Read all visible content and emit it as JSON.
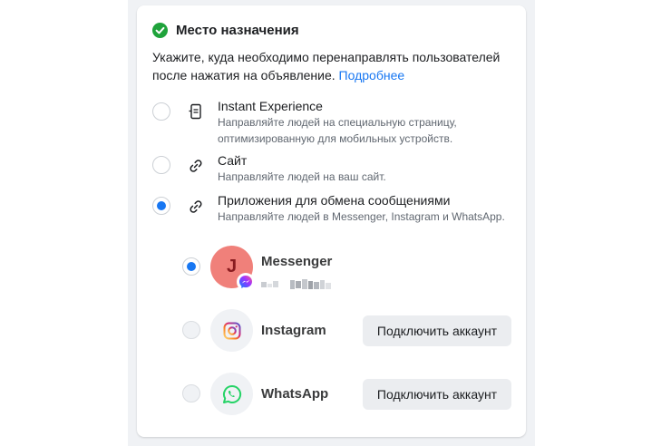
{
  "header": {
    "title": "Место назначения",
    "status_color": "#1fa33b"
  },
  "description": {
    "text": "Укажите, куда необходимо перенаправлять пользователей после нажатия на объявление.",
    "link": "Подробнее"
  },
  "options": [
    {
      "title": "Instant Experience",
      "subtitle": "Направляйте людей на специальную страницу, оптимизированную для мобильных устройств.",
      "icon": "phone-page-icon",
      "selected": false
    },
    {
      "title": "Сайт",
      "subtitle": "Направляйте людей на ваш сайт.",
      "icon": "link-icon",
      "selected": false
    },
    {
      "title": "Приложения для обмена сообщениями",
      "subtitle": "Направляйте людей в Messenger, Instagram и WhatsApp.",
      "icon": "link-icon",
      "selected": true
    }
  ],
  "apps": [
    {
      "name": "Messenger",
      "avatar_letter": "J",
      "selected": true,
      "icon": "messenger-icon"
    },
    {
      "name": "Instagram",
      "button": "Подключить аккаунт",
      "selected": false,
      "icon": "instagram-icon"
    },
    {
      "name": "WhatsApp",
      "button": "Подключить аккаунт",
      "selected": false,
      "icon": "whatsapp-icon"
    }
  ],
  "colors": {
    "accent": "#1877f2",
    "whatsapp": "#25d366",
    "avatar_bg": "#f0807a"
  }
}
